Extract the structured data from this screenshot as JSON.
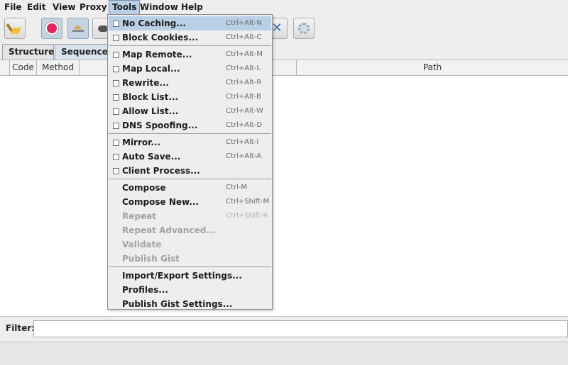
{
  "menubar": {
    "items": [
      "File",
      "Edit",
      "View",
      "Proxy",
      "Tools",
      "Window",
      "Help"
    ],
    "active": "Tools"
  },
  "toolbar": {
    "buttons": [
      {
        "icon": "broom-icon",
        "pressed": false
      },
      {
        "icon": "record-icon",
        "pressed": true
      },
      {
        "icon": "throttle-icon",
        "pressed": true
      },
      {
        "icon": "breakpoint-icon",
        "pressed": false
      },
      {
        "icon": "tools-icon",
        "pressed": false
      },
      {
        "icon": "settings-icon",
        "pressed": false
      }
    ]
  },
  "tabs": [
    "Structure",
    "Sequence"
  ],
  "selected_tab": "Sequence",
  "table": {
    "columns": [
      "Code",
      "Method",
      "Path"
    ]
  },
  "filter": {
    "label": "Filter:",
    "value": ""
  },
  "tools_menu": {
    "groups": [
      [
        {
          "label": "No Caching...",
          "shortcut": "Ctrl+Alt-N",
          "checkbox": true,
          "enabled": true,
          "highlighted": true
        },
        {
          "label": "Block Cookies...",
          "shortcut": "Ctrl+Alt-C",
          "checkbox": true,
          "enabled": true
        }
      ],
      [
        {
          "label": "Map Remote...",
          "shortcut": "Ctrl+Alt-M",
          "checkbox": true,
          "enabled": true
        },
        {
          "label": "Map Local...",
          "shortcut": "Ctrl+Alt-L",
          "checkbox": true,
          "enabled": true
        },
        {
          "label": "Rewrite...",
          "shortcut": "Ctrl+Alt-R",
          "checkbox": true,
          "enabled": true
        },
        {
          "label": "Block List...",
          "shortcut": "Ctrl+Alt-B",
          "checkbox": true,
          "enabled": true
        },
        {
          "label": "Allow List...",
          "shortcut": "Ctrl+Alt-W",
          "checkbox": true,
          "enabled": true
        },
        {
          "label": "DNS Spoofing...",
          "shortcut": "Ctrl+Alt-D",
          "checkbox": true,
          "enabled": true
        }
      ],
      [
        {
          "label": "Mirror...",
          "shortcut": "Ctrl+Alt-I",
          "checkbox": true,
          "enabled": true
        },
        {
          "label": "Auto Save...",
          "shortcut": "Ctrl+Alt-A",
          "checkbox": true,
          "enabled": true
        },
        {
          "label": "Client Process...",
          "shortcut": "",
          "checkbox": true,
          "enabled": true
        }
      ],
      [
        {
          "label": "Compose",
          "shortcut": "Ctrl-M",
          "checkbox": false,
          "enabled": true
        },
        {
          "label": "Compose New...",
          "shortcut": "Ctrl+Shift-M",
          "checkbox": false,
          "enabled": true
        },
        {
          "label": "Repeat",
          "shortcut": "Ctrl+Shift-R",
          "checkbox": false,
          "enabled": false
        },
        {
          "label": "Repeat Advanced...",
          "shortcut": "",
          "checkbox": false,
          "enabled": false
        },
        {
          "label": "Validate",
          "shortcut": "",
          "checkbox": false,
          "enabled": false
        },
        {
          "label": "Publish Gist",
          "shortcut": "",
          "checkbox": false,
          "enabled": false
        }
      ],
      [
        {
          "label": "Import/Export Settings...",
          "shortcut": "",
          "checkbox": false,
          "enabled": true
        },
        {
          "label": "Profiles...",
          "shortcut": "",
          "checkbox": false,
          "enabled": true
        },
        {
          "label": "Publish Gist Settings...",
          "shortcut": "",
          "checkbox": false,
          "enabled": true
        }
      ]
    ]
  },
  "colors": {
    "menu_highlight": "#b8cfe5",
    "record_red": "#e0245e",
    "window_bg": "#eeeeee"
  }
}
